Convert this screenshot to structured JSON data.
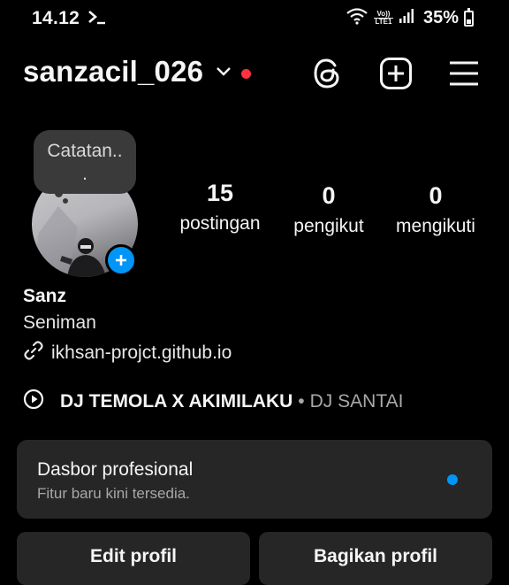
{
  "status_bar": {
    "time": "14.12",
    "terminal_icon": "terminal-icon",
    "volte_top": "Vo))",
    "volte_bottom": "LTE1",
    "battery": "35%"
  },
  "header": {
    "username": "sanzacil_026",
    "icons": [
      "chevron-down-icon",
      "threads-icon",
      "create-icon",
      "menu-icon"
    ],
    "notification_color": "#ff3040"
  },
  "profile": {
    "note": "Catatan..\n.",
    "stats": [
      {
        "value": "15",
        "label": "postingan"
      },
      {
        "value": "0",
        "label": "pengikut"
      },
      {
        "value": "0",
        "label": "mengikuti"
      }
    ],
    "name": "Sanz",
    "category": "Seniman",
    "link": "ikhsan-projct.github.io"
  },
  "music": {
    "title": "DJ TEMOLA X AKIMILAKU",
    "separator": "•",
    "artist": "DJ SANTAI"
  },
  "pro_dashboard": {
    "title": "Dasbor profesional",
    "subtitle": "Fitur baru kini tersedia."
  },
  "buttons": {
    "edit": "Edit profil",
    "share": "Bagikan profil"
  },
  "colors": {
    "accent": "#0095f6",
    "card": "#262626",
    "background": "#000000"
  }
}
